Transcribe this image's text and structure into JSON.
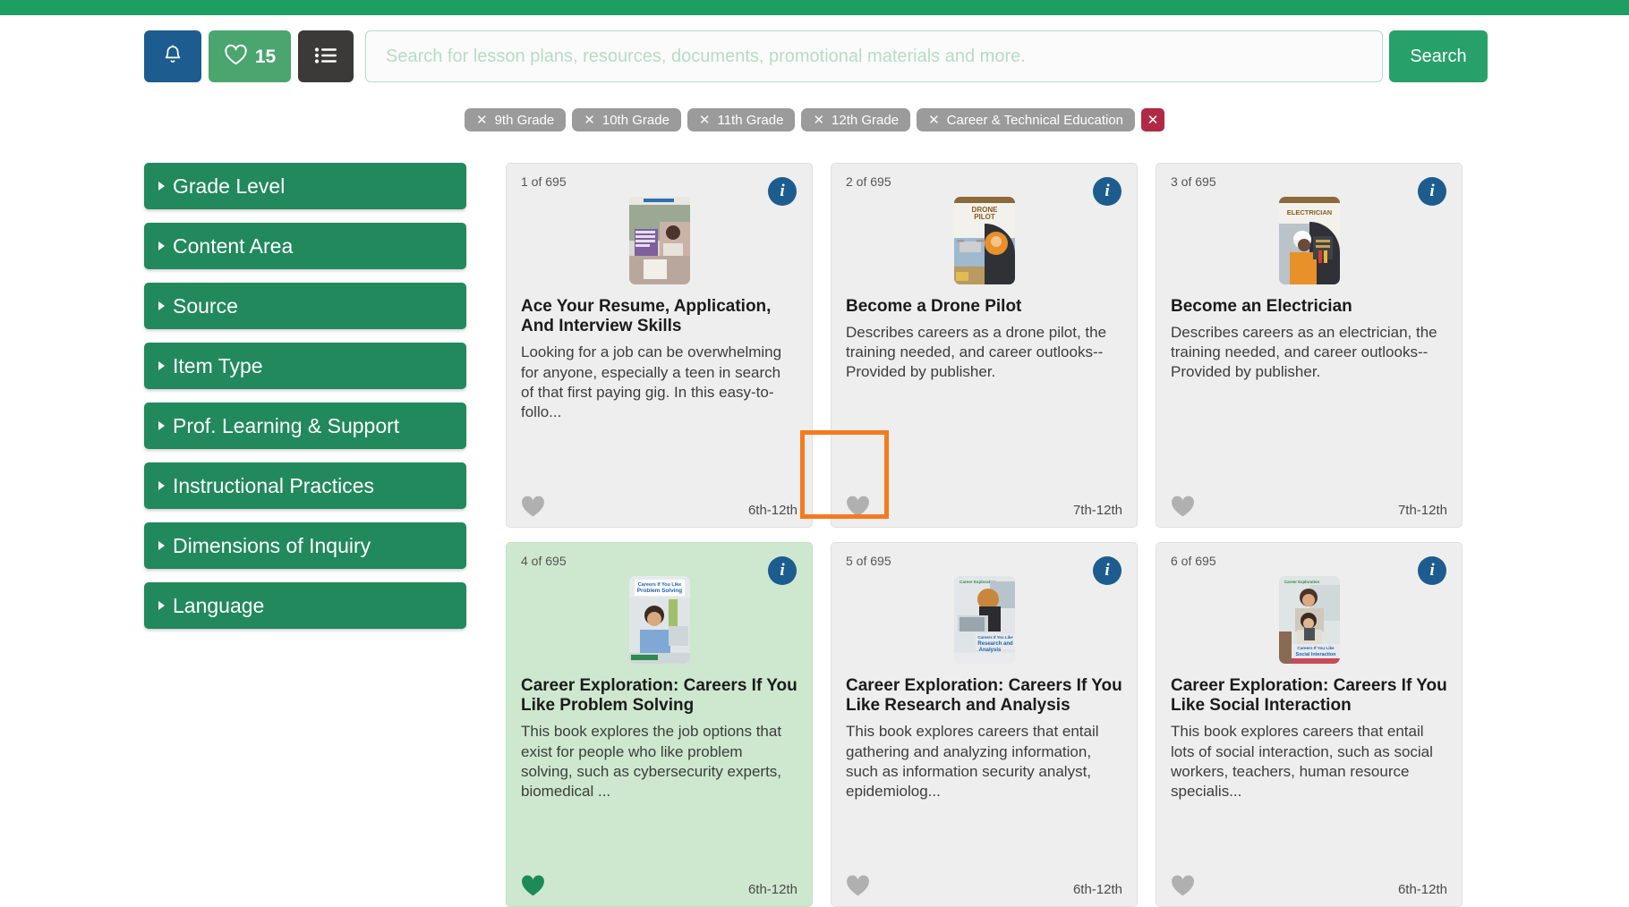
{
  "theme": {
    "brand_green": "#21895c",
    "topbar_green": "#1e9e63",
    "favorite_green": "#4aa56f",
    "bell_blue": "#1d5c8e",
    "list_dark": "#3b3a38",
    "chip_gray": "#9b9b9b",
    "clear_red": "#b02a45",
    "annotation_orange": "#f47b20",
    "card_bg": "#eeeeee",
    "card_favorited_bg": "#cde8ce"
  },
  "header": {
    "notifications_icon": "bell-icon",
    "favorites_icon": "heart-icon",
    "favorites_count": "15",
    "list_icon": "list-icon",
    "search": {
      "value": "",
      "placeholder": "Search for lesson plans, resources, documents, promotional materials and more."
    },
    "search_button_label": "Search"
  },
  "active_filters": {
    "chips": [
      {
        "label": "9th Grade",
        "remove_icon": "close-icon"
      },
      {
        "label": "10th Grade",
        "remove_icon": "close-icon"
      },
      {
        "label": "11th Grade",
        "remove_icon": "close-icon"
      },
      {
        "label": "12th Grade",
        "remove_icon": "close-icon"
      },
      {
        "label": "Career & Technical Education",
        "remove_icon": "close-icon"
      }
    ],
    "clear_all_label": "✕"
  },
  "sidebar": {
    "items": [
      {
        "label": "Grade Level"
      },
      {
        "label": "Content Area"
      },
      {
        "label": "Source"
      },
      {
        "label": "Item Type"
      },
      {
        "label": "Prof. Learning & Support"
      },
      {
        "label": "Instructional Practices"
      },
      {
        "label": "Dimensions of Inquiry"
      },
      {
        "label": "Language"
      }
    ]
  },
  "results": {
    "total": "695",
    "info_badge_label": "i",
    "cards": [
      {
        "count_label": "1 of 695",
        "title": "Ace Your Resume, Application, And Interview Skills",
        "description": "Looking for a job can be overwhelming for anyone, especially a teen in search of that first paying gig. In this easy-to-follo...",
        "grade_range": "6th-12th",
        "favorited": false,
        "thumb": "book-cover-resume"
      },
      {
        "count_label": "2 of 695",
        "title": "Become a Drone Pilot",
        "description": "Describes careers as a drone pilot, the training needed, and career outlooks--Provided by publisher.",
        "grade_range": "7th-12th",
        "favorited": false,
        "thumb": "book-cover-drone"
      },
      {
        "count_label": "3 of 695",
        "title": "Become an Electrician",
        "description": "Describes careers as an electrician, the training needed, and career outlooks--Provided by publisher.",
        "grade_range": "7th-12th",
        "favorited": false,
        "thumb": "book-cover-electrician"
      },
      {
        "count_label": "4 of 695",
        "title": "Career Exploration: Careers If You Like Problem Solving",
        "description": "This book explores the job options that exist for people who like problem solving, such as cybersecurity experts, biomedical ...",
        "grade_range": "6th-12th",
        "favorited": true,
        "thumb": "book-cover-problem-solving"
      },
      {
        "count_label": "5 of 695",
        "title": "Career Exploration: Careers If You Like Research and Analysis",
        "description": "This book explores careers that entail gathering and analyzing information, such as information security analyst, epidemiolog...",
        "grade_range": "6th-12th",
        "favorited": false,
        "thumb": "book-cover-research"
      },
      {
        "count_label": "6 of 695",
        "title": "Career Exploration: Careers If You Like Social Interaction",
        "description": "This book explores careers that entail lots of social interaction, such as social workers, teachers, human resource specialis...",
        "grade_range": "6th-12th",
        "favorited": false,
        "thumb": "book-cover-social"
      }
    ]
  },
  "annotation": {
    "type": "highlight-box",
    "target": "favorite-heart-button-card-2"
  }
}
